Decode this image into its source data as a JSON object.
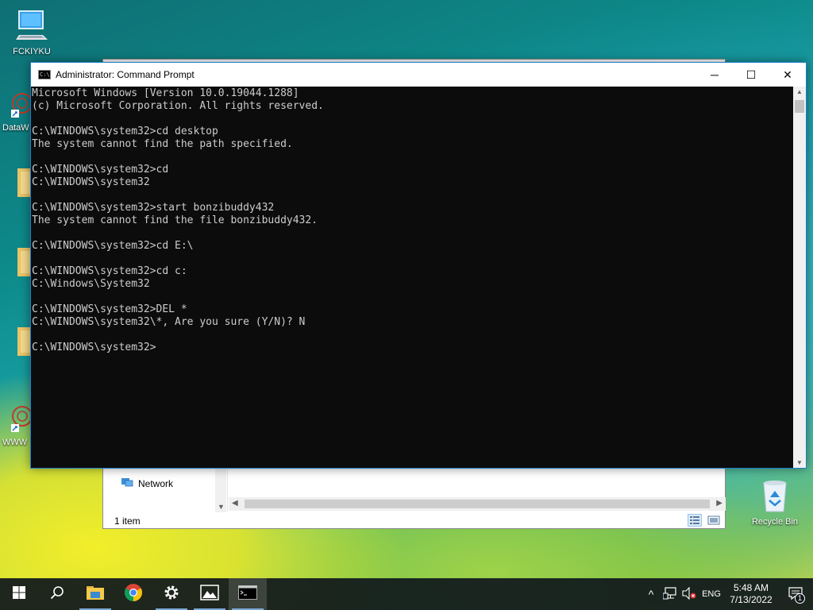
{
  "desktop": {
    "icons": [
      {
        "label": "FCKIYKU",
        "icon": "computer-icon"
      },
      {
        "label": "DataW",
        "icon": "shortcut-app-icon"
      },
      {
        "label": "WWW",
        "icon": "shortcut-app-icon"
      },
      {
        "label": "Recycle Bin",
        "icon": "recycle-bin-icon"
      }
    ]
  },
  "explorer": {
    "nav_item": "Network",
    "status_text": "1 item"
  },
  "cmd": {
    "title": "Administrator: Command Prompt",
    "icon_text": "C:\\",
    "output": "Microsoft Windows [Version 10.0.19044.1288]\n(c) Microsoft Corporation. All rights reserved.\n\nC:\\WINDOWS\\system32>cd desktop\nThe system cannot find the path specified.\n\nC:\\WINDOWS\\system32>cd\nC:\\WINDOWS\\system32\n\nC:\\WINDOWS\\system32>start bonzibuddy432\nThe system cannot find the file bonzibuddy432.\n\nC:\\WINDOWS\\system32>cd E:\\\n\nC:\\WINDOWS\\system32>cd c:\nC:\\Windows\\System32\n\nC:\\WINDOWS\\system32>DEL *\nC:\\WINDOWS\\system32\\*, Are you sure (Y/N)? N\n\nC:\\WINDOWS\\system32>",
    "minimize_glyph": "─",
    "maximize_glyph": "☐",
    "close_glyph": "✕"
  },
  "taskbar": {
    "items": [
      "start-icon",
      "search-icon",
      "file-explorer-icon",
      "chrome-icon",
      "settings-icon",
      "photos-icon",
      "command-prompt-icon"
    ],
    "tray": {
      "chevron_glyph": "^",
      "language": "ENG",
      "time": "5:48 AM",
      "date": "7/13/2022",
      "notification_count": "1"
    }
  },
  "colors": {
    "console_bg": "#0c0c0c",
    "console_text": "#cccccc",
    "accent": "#1e7ec8",
    "taskbar_bg": "#10181c"
  }
}
